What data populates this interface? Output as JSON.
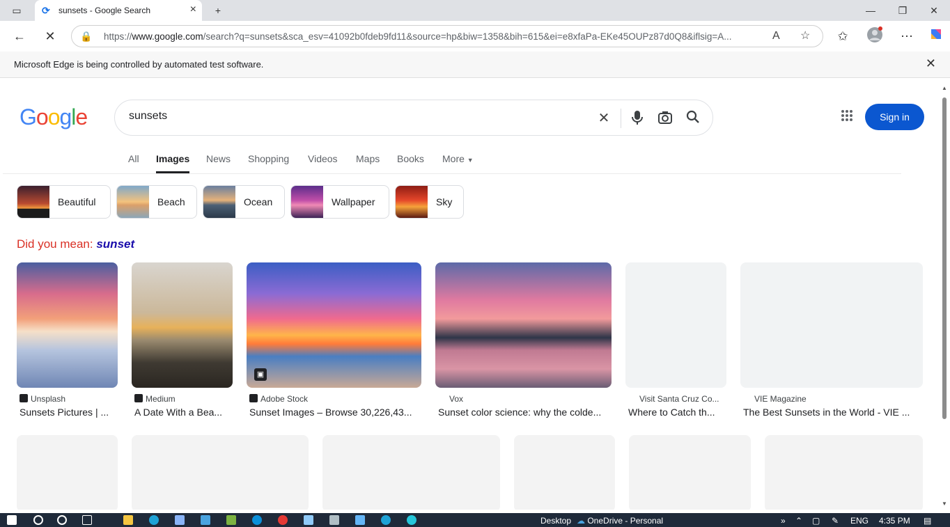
{
  "browser": {
    "tab_title": "sunsets - Google Search",
    "url_prefix": "https://",
    "url_host": "www.google.com",
    "url_path": "/search?q=sunsets&sca_esv=41092b0fdeb9fd11&source=hp&biw=1358&bih=615&ei=e8xfaPa-EKe45OUPz87d0Q8&iflsig=A...",
    "infobar_message": "Microsoft Edge is being controlled by automated test software."
  },
  "search": {
    "query": "sunsets",
    "sign_in": "Sign in",
    "tabs": [
      "All",
      "Images",
      "News",
      "Shopping",
      "Videos",
      "Maps",
      "Books",
      "More"
    ],
    "selected_tab": "Images"
  },
  "chips": [
    "Beautiful",
    "Beach",
    "Ocean",
    "Wallpaper",
    "Sky"
  ],
  "did_you_mean": {
    "prefix": "Did you mean: ",
    "suggestion": "sunset"
  },
  "results": [
    {
      "source": "Unsplash",
      "title": "Sunsets Pictures | ..."
    },
    {
      "source": "Medium",
      "title": "A Date With a Bea..."
    },
    {
      "source": "Adobe Stock",
      "title": "Sunset Images – Browse 30,226,43..."
    },
    {
      "source": "Vox",
      "title": "Sunset color science: why the colde..."
    },
    {
      "source": "Visit Santa Cruz Co...",
      "title": "Where to Catch th..."
    },
    {
      "source": "VIE Magazine",
      "title": "The Best Sunsets in the World - VIE ..."
    }
  ],
  "taskbar": {
    "desktop": "Desktop",
    "onedrive": "OneDrive - Personal",
    "lang": "ENG",
    "time": "4:35 PM"
  },
  "colors": {
    "accent": "#0b57d0",
    "link": "#1a0dab",
    "warning": "#d93025"
  }
}
